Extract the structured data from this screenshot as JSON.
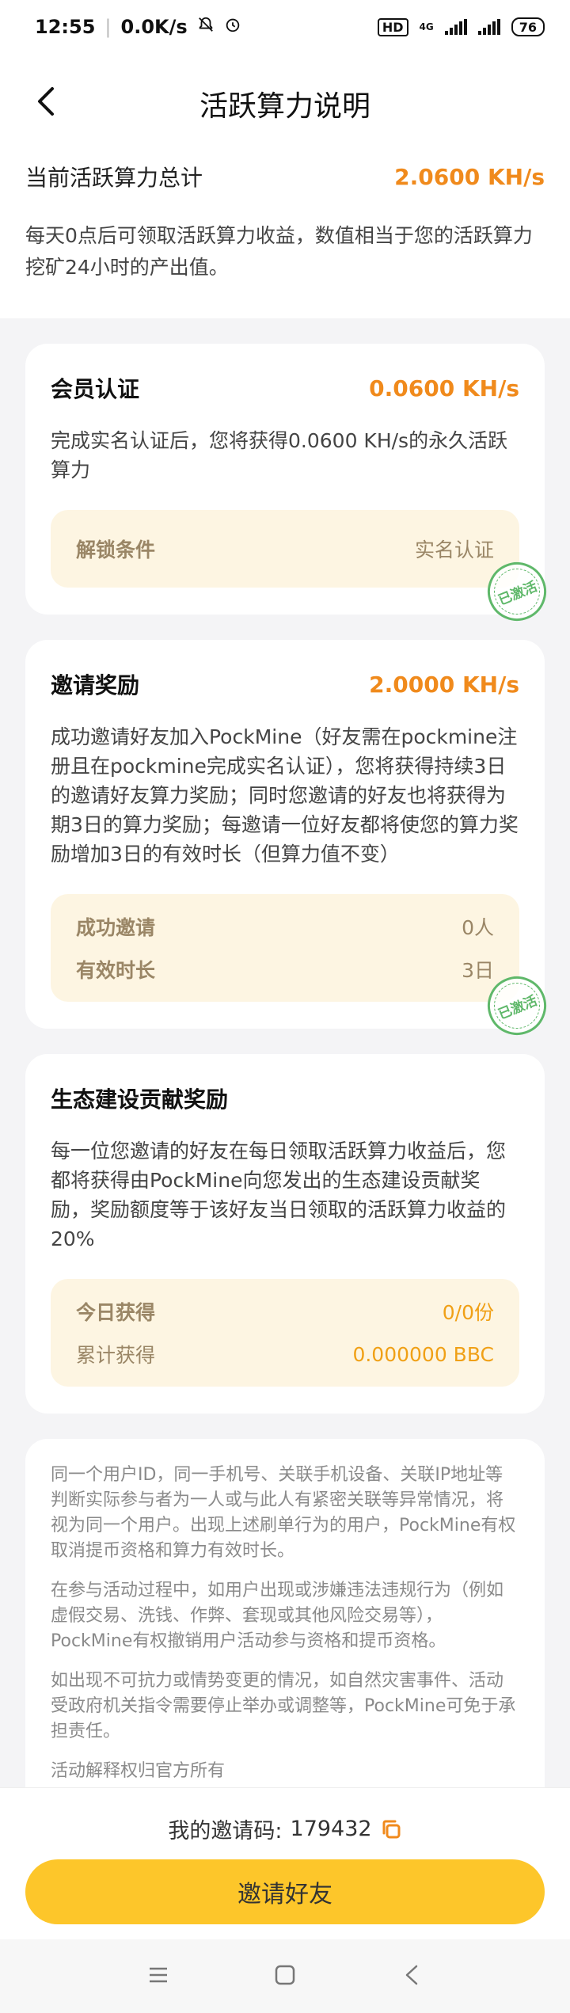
{
  "status_bar": {
    "time": "12:55",
    "net_speed": "0.0K/s",
    "hd": "HD",
    "network_type": "4G",
    "battery": "76"
  },
  "header": {
    "title": "活跃算力说明",
    "back_icon": "chevron-left-icon"
  },
  "summary": {
    "label": "当前活跃算力总计",
    "value": "2.0600 KH/s",
    "desc": "每天0点后可领取活跃算力收益，数值相当于您的活跃算力挖矿24小时的产出值。"
  },
  "cards": {
    "member": {
      "title": "会员认证",
      "value": "0.0600 KH/s",
      "desc": "完成实名认证后，您将获得0.0600 KH/s的永久活跃算力",
      "cond_label": "解锁条件",
      "cond_value": "实名认证",
      "stamp": "已激活"
    },
    "invite": {
      "title": "邀请奖励",
      "value": "2.0000 KH/s",
      "desc": "成功邀请好友加入PockMine（好友需在pockmine注册且在pockmine完成实名认证），您将获得持续3日的邀请好友算力奖励；同时您邀请的好友也将获得为期3日的算力奖励；每邀请一位好友都将使您的算力奖励增加3日的有效时长（但算力值不变）",
      "success_label": "成功邀请",
      "success_value": "0人",
      "duration_label": "有效时长",
      "duration_value": "3日",
      "stamp": "已激活"
    },
    "eco": {
      "title": "生态建设贡献奖励",
      "desc": "每一位您邀请的好友在每日领取活跃算力收益后，您都将获得由PockMine向您发出的生态建设贡献奖励，奖励额度等于该好友当日领取的活跃算力收益的20%",
      "today_label": "今日获得",
      "today_value": "0/0份",
      "total_label": "累计获得",
      "total_value": "0.000000 BBC"
    }
  },
  "rules": [
    "同一个用户ID，同一手机号、关联手机设备、关联IP地址等判断实际参与者为一人或与此人有紧密关联等异常情况，将视为同一个用户。出现上述刷单行为的用户，PockMine有权取消提币资格和算力有效时长。",
    "在参与活动过程中，如用户出现或涉嫌违法违规行为（例如虚假交易、洗钱、作弊、套现或其他风险交易等），PockMine有权撤销用户活动参与资格和提币资格。",
    "如出现不可抗力或情势变更的情况，如自然灾害事件、活动受政府机关指令需要停止举办或调整等，PockMine可免于承担责任。",
    "活动解释权归官方所有"
  ],
  "bottom": {
    "invite_code_label": "我的邀请码:",
    "invite_code": "179432",
    "copy_icon": "copy-icon",
    "invite_button": "邀请好友"
  },
  "navbar": {
    "menu_icon": "menu-icon",
    "home_icon": "square-home-icon",
    "back_icon": "triangle-back-icon"
  },
  "colors": {
    "accent_orange": "#f08a1c",
    "button_yellow": "#fdc62a",
    "cond_bg": "#fdf5e2",
    "stamp_green": "#5fb86a"
  }
}
